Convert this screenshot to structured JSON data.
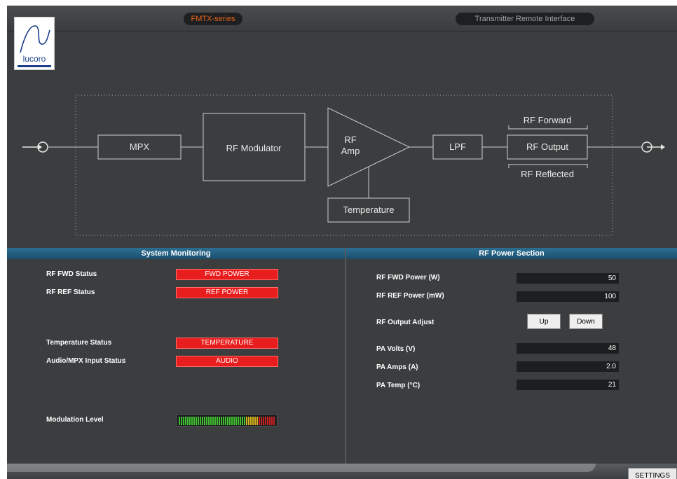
{
  "header": {
    "series": "FMTX-series",
    "title": "Transmitter Remote Interface",
    "logo_text": "lucoro"
  },
  "diagram": {
    "blocks": {
      "mpx": "MPX",
      "modulator": "RF Modulator",
      "amp_line1": "RF",
      "amp_line2": "Amp",
      "lpf": "LPF",
      "output": "RF Output",
      "temperature": "Temperature",
      "forward": "RF Forward",
      "reflected": "RF Reflected"
    }
  },
  "system_monitoring": {
    "title": "System Monitoring",
    "rows": [
      {
        "label": "RF FWD Status",
        "status": "FWD POWER"
      },
      {
        "label": "RF REF Status",
        "status": "REF POWER"
      },
      {
        "label": "Temperature Status",
        "status": "TEMPERATURE"
      },
      {
        "label": "Audio/MPX Input Status",
        "status": "AUDIO"
      }
    ],
    "modulation_label": "Modulation Level",
    "modulation_level": 1.0,
    "status_color": "#e81d1d"
  },
  "rf_power": {
    "title": "RF Power Section",
    "fwd_power": {
      "label": "RF FWD Power (W)",
      "value": "50"
    },
    "ref_power": {
      "label": "RF REF Power (mW)",
      "value": "100"
    },
    "adjust": {
      "label": "RF Output Adjust",
      "up": "Up",
      "down": "Down"
    },
    "pa_volts": {
      "label": "PA Volts (V)",
      "value": "48"
    },
    "pa_amps": {
      "label": "PA Amps (A)",
      "value": "2.0"
    },
    "pa_temp": {
      "label": "PA Temp (°C)",
      "value": "21"
    }
  },
  "footer": {
    "settings": "SETTINGS"
  },
  "colors": {
    "background": "#3b3d3f",
    "accent": "#e8641c",
    "section_bar": "#2c6f93"
  }
}
